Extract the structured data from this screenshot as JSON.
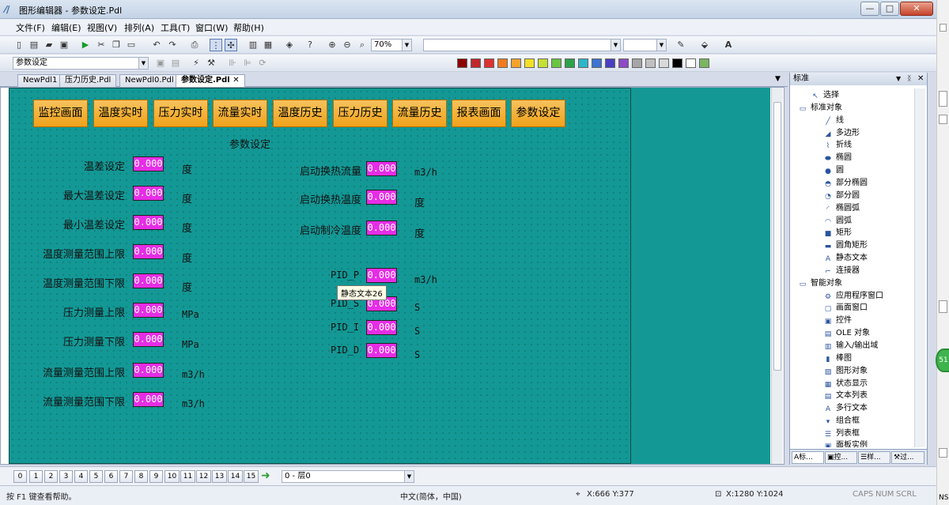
{
  "window": {
    "title": "图形编辑器 - 参数设定.Pdl",
    "controls": [
      "—",
      "□",
      "✕"
    ]
  },
  "menu": [
    "文件(F)",
    "编辑(E)",
    "视图(V)",
    "排列(A)",
    "工具(T)",
    "窗口(W)",
    "帮助(H)"
  ],
  "toolbar": {
    "zoom": "70%",
    "font_combo": "",
    "size_combo": "",
    "object_combo": "参数设定"
  },
  "palette": [
    "#8b0000",
    "#c0282d",
    "#e03131",
    "#f07a1e",
    "#f4a32a",
    "#f5e025",
    "#c6e033",
    "#69c542",
    "#2ca24a",
    "#2fb5c9",
    "#3b73cf",
    "#4a3fc0",
    "#8d4bc4",
    "#a6a6a6",
    "#c0c0c0",
    "#d9d9d9",
    "#000000",
    "#ffffff",
    "#7bb661"
  ],
  "tabs": [
    {
      "label": "NewPdl1",
      "active": false
    },
    {
      "label": "压力历史.Pdl",
      "active": false
    },
    {
      "label": "NewPdl0.Pdl",
      "active": false
    },
    {
      "label": "参数设定.Pdl",
      "active": true
    }
  ],
  "nav_buttons": [
    "监控画面",
    "温度实时",
    "压力实时",
    "流量实时",
    "温度历史",
    "压力历史",
    "流量历史",
    "报表画面",
    "参数设定"
  ],
  "page_title": "参数设定",
  "left_params": [
    {
      "label": "温差设定",
      "value": "0.000",
      "unit": "度"
    },
    {
      "label": "最大温差设定",
      "value": "0.000",
      "unit": "度"
    },
    {
      "label": "最小温差设定",
      "value": "0.000",
      "unit": "度"
    },
    {
      "label": "温度测量范围上限",
      "value": "0.000",
      "unit": "度"
    },
    {
      "label": "温度测量范围下限",
      "value": "0.000",
      "unit": "度"
    },
    {
      "label": "压力测量上限",
      "value": "0.000",
      "unit": "MPa"
    },
    {
      "label": "压力测量下限",
      "value": "0.000",
      "unit": "MPa"
    },
    {
      "label": "流量测量范围上限",
      "value": "0.000",
      "unit": "m3/h"
    },
    {
      "label": "流量测量范围下限",
      "value": "0.000",
      "unit": "m3/h"
    }
  ],
  "right_params": [
    {
      "label": "启动换热流量",
      "value": "0.000",
      "unit": "m3/h"
    },
    {
      "label": "启动换热温度",
      "value": "0.000",
      "unit": "度"
    },
    {
      "label": "启动制冷温度",
      "value": "0.000",
      "unit": "度"
    }
  ],
  "pid_params": [
    {
      "label": "PID_P",
      "value": "0.000",
      "unit": "m3/h"
    },
    {
      "label": "PID_S",
      "value": "0.000",
      "unit": "S"
    },
    {
      "label": "PID_I",
      "value": "0.000",
      "unit": "S"
    },
    {
      "label": "PID_D",
      "value": "0.000",
      "unit": "S"
    }
  ],
  "tooltip": "静态文本26",
  "panel": {
    "title": "标准",
    "select_label": "选择",
    "groups": [
      {
        "label": "标准对象",
        "items": [
          "线",
          "多边形",
          "折线",
          "椭圆",
          "圆",
          "部分椭圆",
          "部分圆",
          "椭圆弧",
          "圆弧",
          "矩形",
          "圆角矩形",
          "静态文本",
          "连接器"
        ]
      },
      {
        "label": "智能对象",
        "items": [
          "应用程序窗口",
          "画面窗口",
          "控件",
          "OLE 对象",
          "输入/输出域",
          "棒图",
          "图形对象",
          "状态显示",
          "文本列表",
          "多行文本",
          "组合框",
          "列表框",
          "面板实例"
        ]
      }
    ],
    "bottom_tabs": [
      "标...",
      "控...",
      "样...",
      "过..."
    ]
  },
  "layers": {
    "buttons": [
      "0",
      "1",
      "2",
      "3",
      "4",
      "5",
      "6",
      "7",
      "8",
      "9",
      "10",
      "11",
      "12",
      "13",
      "14",
      "15"
    ],
    "combo": "0 - 层0"
  },
  "status": {
    "help": "按 F1 键查看帮助。",
    "language": "中文(简体，中国)",
    "cursor": "X:666 Y:377",
    "size": "X:1280 Y:1024",
    "caps": "CAPS",
    "num": "NUM",
    "scrl": "SCRL"
  },
  "side_badge": "51",
  "edge_text": "NS"
}
